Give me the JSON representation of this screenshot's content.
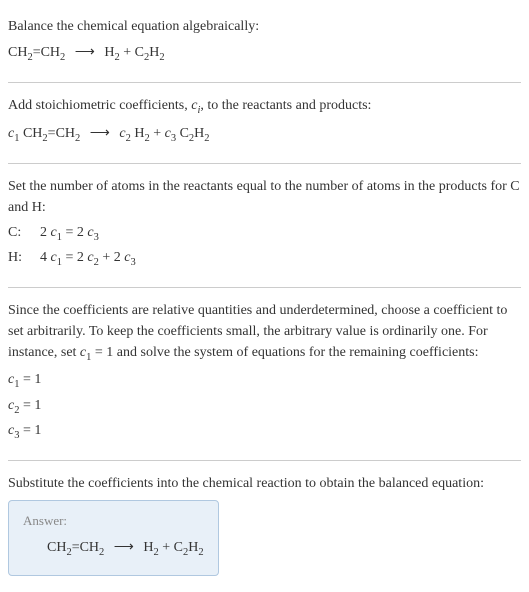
{
  "intro": {
    "title": "Balance the chemical equation algebraically:",
    "reactant": "CH",
    "r_sub1": "2",
    "r_mid": "=CH",
    "r_sub2": "2",
    "arrow": "⟶",
    "p1": "H",
    "p1_sub": "2",
    "plus": " + ",
    "p2a": "C",
    "p2a_sub": "2",
    "p2b": "H",
    "p2b_sub": "2"
  },
  "stoich": {
    "text_a": "Add stoichiometric coefficients, ",
    "ci": "c",
    "ci_sub": "i",
    "text_b": ", to the reactants and products:",
    "c1": "c",
    "c1s": "1",
    "sp": " ",
    "c2": "c",
    "c2s": "2",
    "c3": "c",
    "c3s": "3"
  },
  "atoms": {
    "text": "Set the number of atoms in the reactants equal to the number of atoms in the products for C and H:",
    "c_label": "C:",
    "c_eq_a": "2 ",
    "c_eq_b": " = 2 ",
    "h_label": "H:",
    "h_eq_a": "4 ",
    "h_eq_b": " = 2 ",
    "h_eq_c": " + 2 "
  },
  "solve": {
    "text_a": "Since the coefficients are relative quantities and underdetermined, choose a coefficient to set arbitrarily. To keep the coefficients small, the arbitrary value is ordinarily one. For instance, set ",
    "text_b": " = 1 and solve the system of equations for the remaining coefficients:",
    "r1": " = 1",
    "r2": " = 1",
    "r3": " = 1"
  },
  "final": {
    "text": "Substitute the coefficients into the chemical reaction to obtain the balanced equation:",
    "answer_label": "Answer:"
  },
  "chart_data": {
    "type": "table",
    "title": "Balanced chemical equation",
    "equation_unbalanced": "CH2=CH2 -> H2 + C2H2",
    "coefficients": {
      "c1": 1,
      "c2": 1,
      "c3": 1
    },
    "atom_balance": [
      {
        "element": "C",
        "lhs": "2 c1",
        "rhs": "2 c3"
      },
      {
        "element": "H",
        "lhs": "4 c1",
        "rhs": "2 c2 + 2 c3"
      }
    ],
    "equation_balanced": "CH2=CH2 -> H2 + C2H2"
  }
}
